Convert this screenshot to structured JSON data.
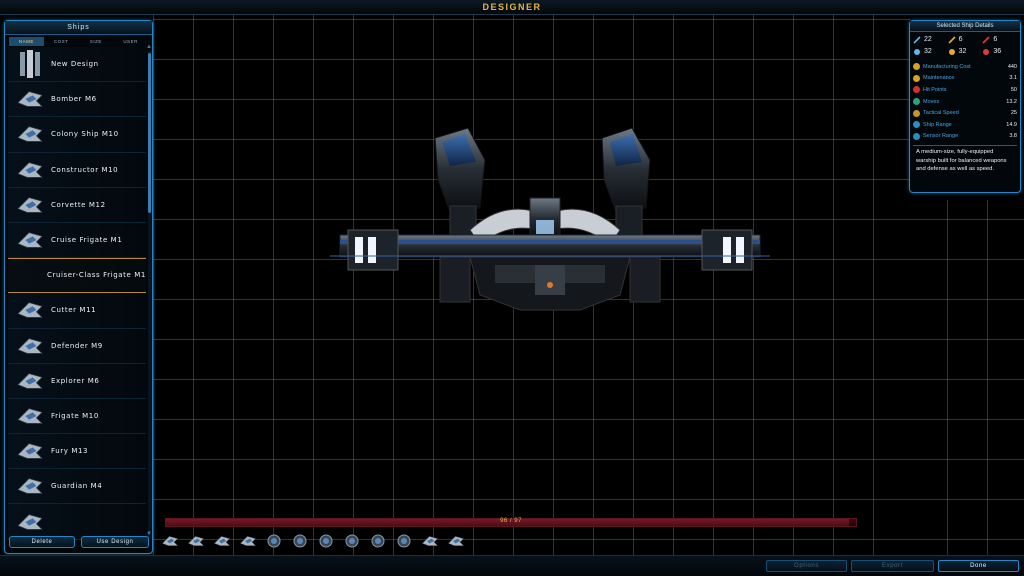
{
  "window": {
    "title": "Designer"
  },
  "left_panel": {
    "title": "Ships",
    "sort_tabs": [
      "Name",
      "Cost",
      "Size",
      "User"
    ],
    "active_sort": 0,
    "ships": [
      {
        "name": "New Design",
        "icon": "new-design-icon"
      },
      {
        "name": "Bomber M6",
        "icon": "bomber-ship-icon"
      },
      {
        "name": "Colony Ship M10",
        "icon": "colony-ship-icon"
      },
      {
        "name": "Constructor M10",
        "icon": "constructor-ship-icon"
      },
      {
        "name": "Corvette M12",
        "icon": "corvette-ship-icon"
      },
      {
        "name": "Cruise Frigate M1",
        "icon": "frigate-ship-icon"
      },
      {
        "name": "Cruiser-Class Frigate M1",
        "icon": "",
        "selected": true
      },
      {
        "name": "Cutter M11",
        "icon": "cutter-ship-icon"
      },
      {
        "name": "Defender M9",
        "icon": "defender-ship-icon"
      },
      {
        "name": "Explorer M6",
        "icon": "explorer-ship-icon"
      },
      {
        "name": "Frigate M10",
        "icon": "frigate-ship-icon"
      },
      {
        "name": "Fury M13",
        "icon": "fury-ship-icon"
      },
      {
        "name": "Guardian M4",
        "icon": "guardian-ship-icon"
      },
      {
        "name": "",
        "icon": "ship-icon"
      }
    ],
    "delete_label": "Delete",
    "use_design_label": "Use Design"
  },
  "details": {
    "title": "Selected Ship Details",
    "stats": [
      {
        "icon": "beam-weapon-icon",
        "value": "22",
        "color": "#5fb6ea"
      },
      {
        "icon": "missile-weapon-icon",
        "value": "6",
        "color": "#e8a83a"
      },
      {
        "icon": "kinetic-weapon-icon",
        "value": "6",
        "color": "#e03a3a"
      },
      {
        "icon": "shield-defense-icon",
        "value": "32",
        "color": "#5fb6ea"
      },
      {
        "icon": "point-defense-icon",
        "value": "32",
        "color": "#e8a83a"
      },
      {
        "icon": "armor-defense-icon",
        "value": "36",
        "color": "#e03a3a"
      }
    ],
    "attributes": [
      {
        "label": "Manufacturing Cost",
        "value": "440",
        "color": "#d8a12e"
      },
      {
        "label": "Maintenance",
        "value": "3.1",
        "color": "#d8a12e"
      },
      {
        "label": "Hit Points",
        "value": "50",
        "color": "#d2302e"
      },
      {
        "label": "Moves",
        "value": "13.2",
        "color": "#2aa47a"
      },
      {
        "label": "Tactical Speed",
        "value": "25",
        "color": "#c9962a"
      },
      {
        "label": "Ship Range",
        "value": "14.9",
        "color": "#2a8fc0"
      },
      {
        "label": "Sensor Range",
        "value": "3.8",
        "color": "#2a8fc0"
      }
    ],
    "description": "A medium-size, fully-equipped warship built for balanced weapons and defense as well as speed."
  },
  "capacity": {
    "label": "96 / 97",
    "used": 96,
    "total": 97
  },
  "component_tray": [
    "engine-component-icon",
    "life-support-component-icon",
    "hyperdrive-component-icon",
    "sensor-component-icon",
    "armor-component-icon",
    "shield-component-icon",
    "point-defense-component-icon",
    "beam-component-icon",
    "missile-component-icon",
    "support-component-icon",
    "thruster-component-icon",
    "cannon-component-icon"
  ],
  "bottom_buttons": {
    "options": "Options",
    "export": "Export",
    "done": "Done"
  },
  "colors": {
    "accent_blue": "#2a86c0",
    "accent_gold": "#e8b34a",
    "capacity_red": "#7a1824"
  }
}
